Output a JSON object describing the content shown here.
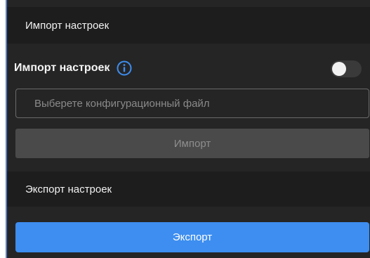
{
  "import_section": {
    "header": "Импорт настроек",
    "row_label": "Импорт настроек",
    "info_icon": "info-circle-icon",
    "toggle_on": false,
    "file_input_placeholder": "Выберете конфигурационный файл",
    "import_button": "Импорт"
  },
  "export_section": {
    "header": "Экспорт настроек",
    "export_button": "Экспорт"
  },
  "colors": {
    "panel_bg": "#252525",
    "header_bg": "#1d1d1d",
    "accent": "#3d8ef0",
    "info_icon": "#3d8ef0",
    "disabled_button": "#4a4a4a"
  }
}
